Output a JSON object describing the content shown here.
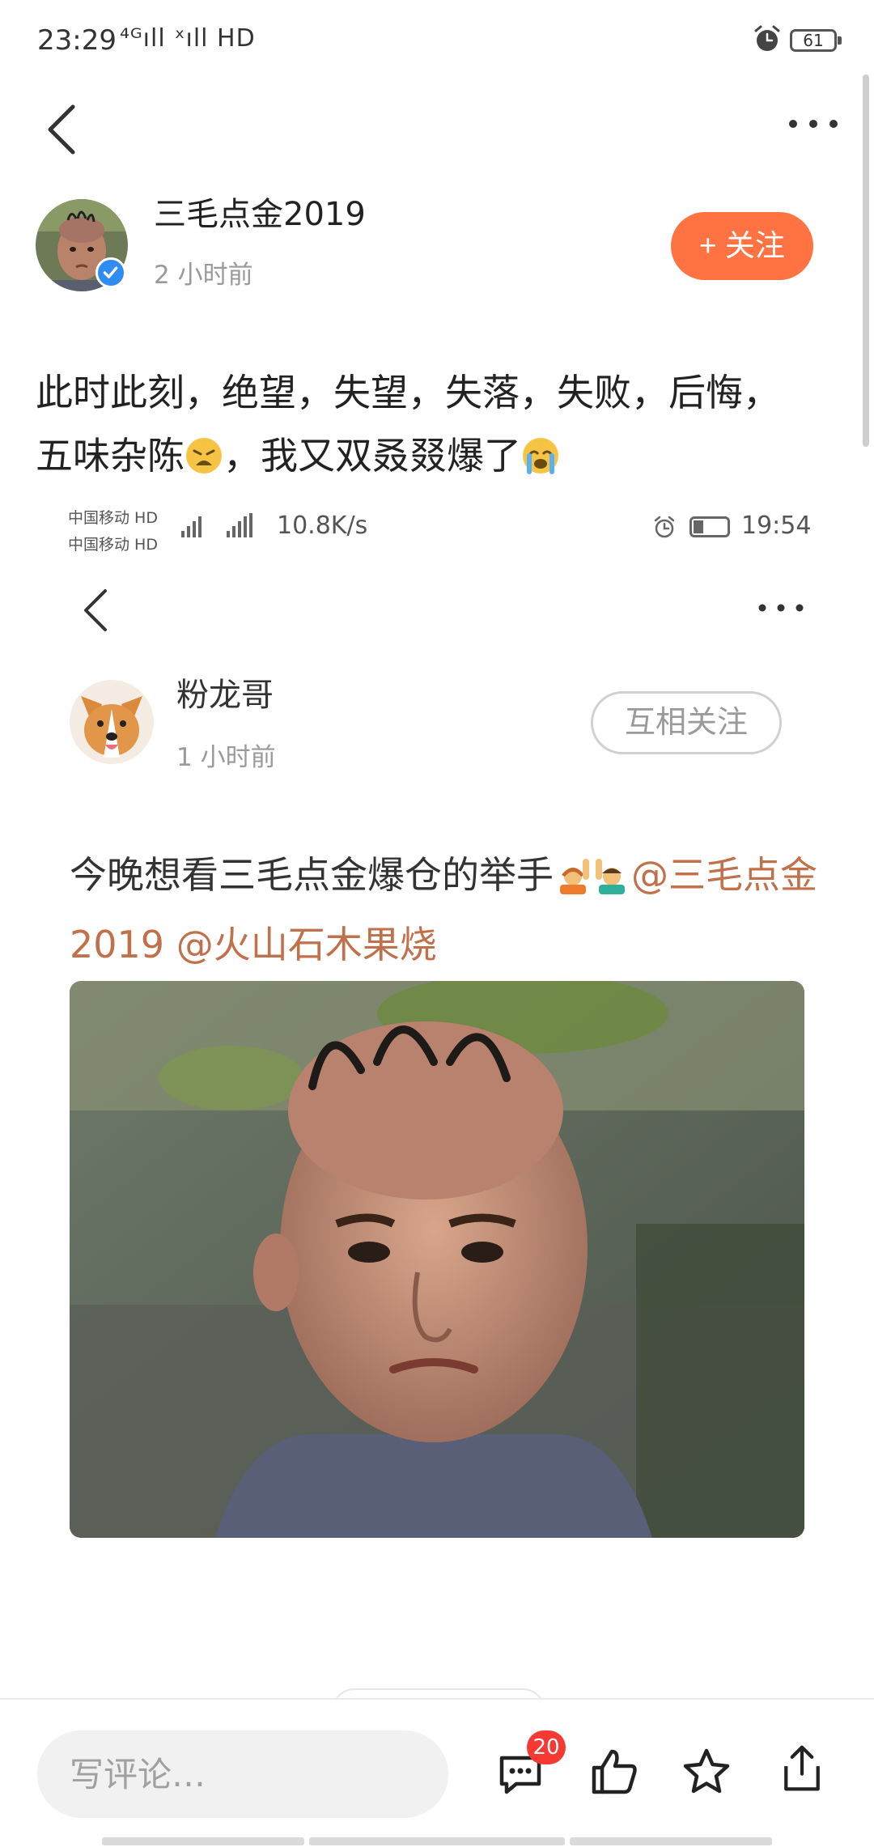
{
  "status_bar": {
    "time": "23:29",
    "network": "⁴ᴳıll ˣıll HD",
    "battery": "61"
  },
  "post": {
    "author": "三毛点金2019",
    "time": "2 小时前",
    "follow_label": "+ 关注",
    "text_part1": "此时此刻，绝望，失望，失落，失败，后悔，五味杂陈",
    "text_part2": "，我又双叒叕爆了"
  },
  "quoted_screenshot": {
    "status_bar": {
      "carrier_line1": "中国移动 HD",
      "carrier_line2": "中国移动 HD",
      "speed": "10.8K/s",
      "clock": "19:54"
    },
    "author": "粉龙哥",
    "time": "1 小时前",
    "mutual_follow_label": "互相关注",
    "text_main": "今晚想看三毛点金爆仓的举手",
    "mention1": "@三毛点金2019",
    "mention2": "@火山石木果烧"
  },
  "bottom_bar": {
    "comment_placeholder": "写评论…",
    "comment_count": "20"
  },
  "colors": {
    "accent": "#ff7242",
    "mention": "#c0704a",
    "badge": "#f43a32",
    "verified": "#2f8cf2"
  },
  "icons": [
    "back-icon",
    "more-icon",
    "verified-icon",
    "alarm-icon",
    "comment-icon",
    "like-icon",
    "star-icon",
    "share-icon"
  ]
}
